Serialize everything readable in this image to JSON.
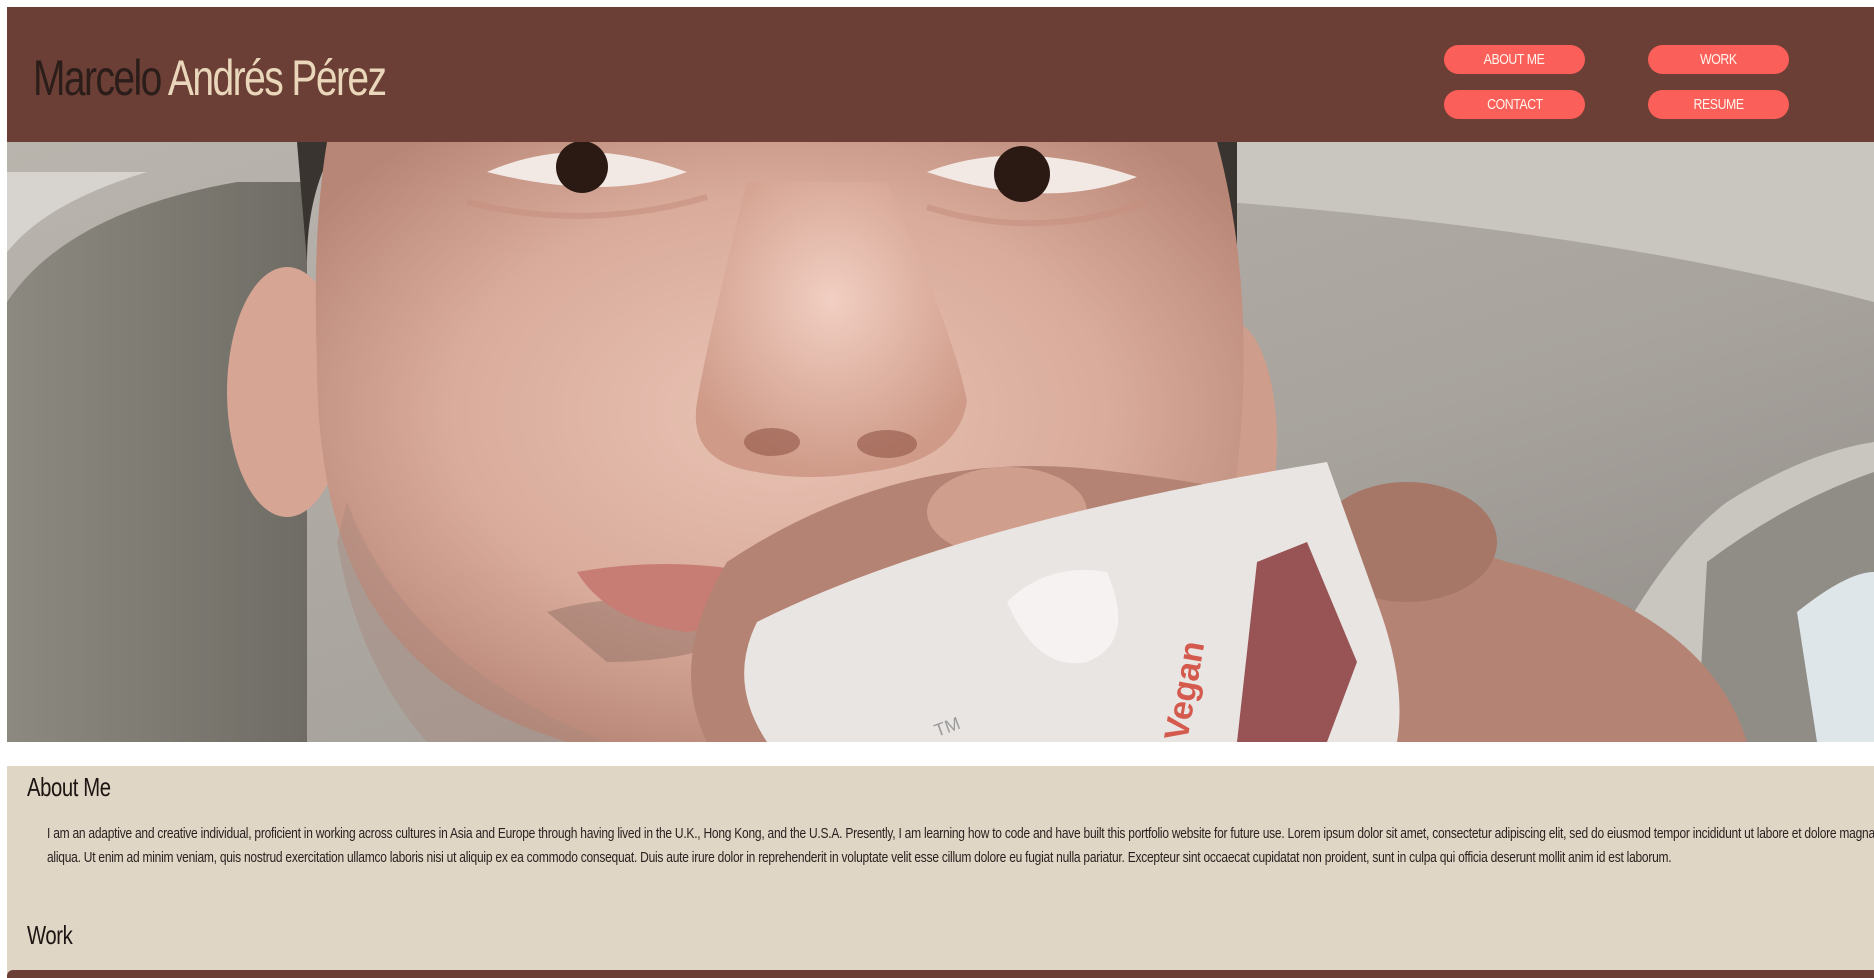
{
  "header": {
    "first_name": "Marcelo",
    "last_name": "Andrés Pérez",
    "nav": {
      "about": "ABOUT ME",
      "work": "WORK",
      "contact": "CONTACT",
      "resume": "RESUME"
    }
  },
  "hero": {
    "alt": "Portrait photo",
    "package_text": "Vegan",
    "tm": "TM"
  },
  "about": {
    "heading": "About Me",
    "text": "I am an adaptive and creative individual, proficient in working across cultures in Asia and Europe through having lived in the U.K., Hong Kong, and the U.S.A. Presently, I am learning how to code and have built this portfolio website for future use. Lorem ipsum dolor sit amet, consectetur adipiscing elit, sed do eiusmod tempor incididunt ut labore et dolore magna aliqua. Ut enim ad minim veniam, quis nostrud exercitation ullamco laboris nisi ut aliquip ex ea commodo consequat. Duis aute irure dolor in reprehenderit in voluptate velit esse cillum dolore eu fugiat nulla pariatur. Excepteur sint occaecat cupidatat non proident, sunt in culpa qui officia deserunt mollit anim id est laborum."
  },
  "work": {
    "heading": "Work"
  },
  "colors": {
    "header_bg": "#6b3f35",
    "accent_button": "#fb5f59",
    "title_dark": "#2b1d19",
    "title_light": "#ead7bb",
    "content_bg": "#e0d6c5"
  }
}
